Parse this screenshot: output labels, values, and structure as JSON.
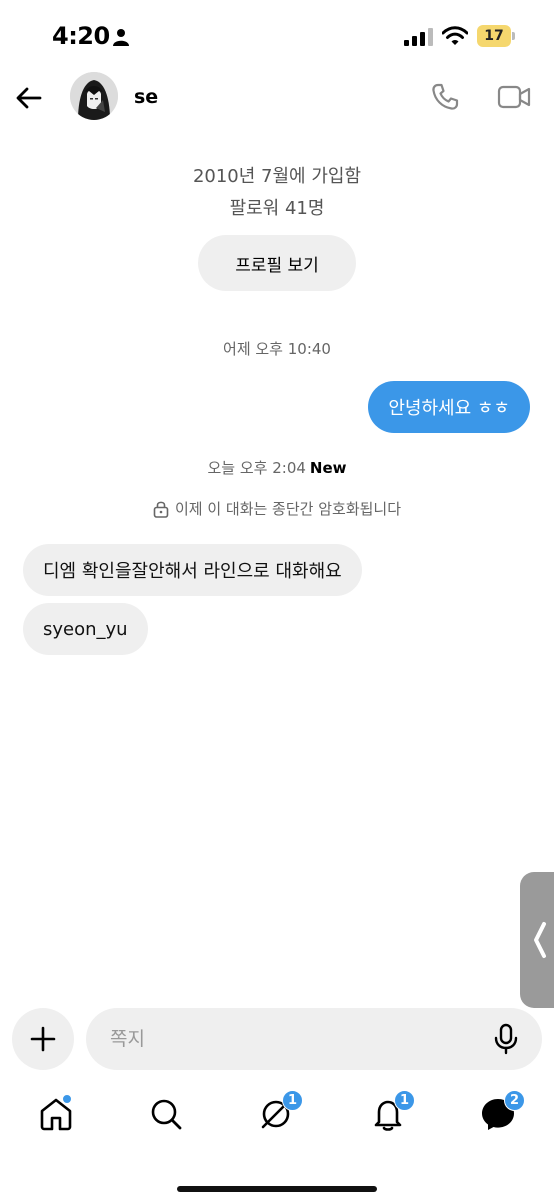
{
  "status_bar": {
    "time": "4:20",
    "battery": "17"
  },
  "header": {
    "username": "se"
  },
  "profile": {
    "joined": "2010년 7월에 가입함",
    "followers": "팔로워 41명",
    "view_profile_label": "프로필 보기"
  },
  "messages": {
    "timestamp_1": "어제 오후 10:40",
    "outgoing_1": "안녕하세요 ㅎㅎ",
    "timestamp_2": "오늘 오후 2:04",
    "new_label": "New",
    "encryption_notice": "이제 이 대화는 종단간 암호화됩니다",
    "incoming_1": "디엠 확인을잘안해서 라인으로 대화해요",
    "incoming_2": "syeon_yu"
  },
  "composer": {
    "placeholder": "쪽지"
  },
  "nav": {
    "threads_badge": "1",
    "bell_badge": "1",
    "dm_badge": "2"
  },
  "colors": {
    "accent": "#3b97e8",
    "bubble_incoming": "#efefef",
    "battery": "#f5d76e"
  },
  "icons": [
    "person-icon",
    "signal-icon",
    "wifi-icon",
    "battery-icon",
    "back-arrow-icon",
    "phone-icon",
    "video-camera-icon",
    "lock-icon",
    "chevron-left-icon",
    "plus-icon",
    "microphone-icon",
    "home-icon",
    "search-icon",
    "threads-icon",
    "bell-icon",
    "messenger-icon"
  ]
}
